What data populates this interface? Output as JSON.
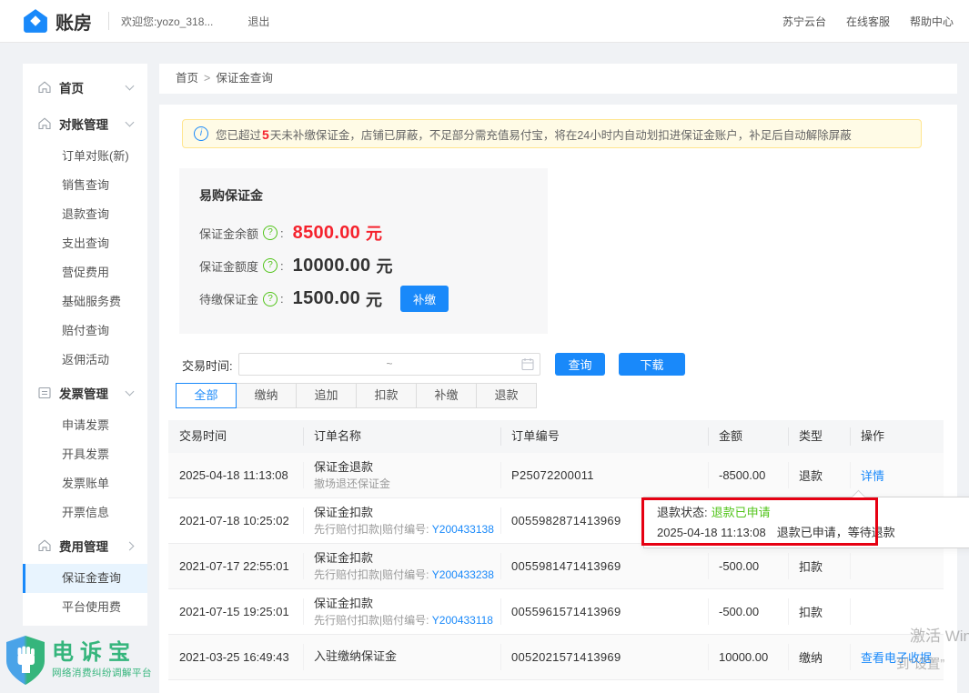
{
  "header": {
    "brand": "账房",
    "welcome": "欢迎您:yozo_318...",
    "logout": "退出",
    "nav": [
      "苏宁云台",
      "在线客服",
      "帮助中心"
    ]
  },
  "breadcrumb": {
    "home": "首页",
    "sep": ">",
    "current": "保证金查询"
  },
  "sidebar": {
    "items": [
      {
        "label": "首页"
      },
      {
        "label": "对账管理"
      },
      {
        "label": "订单对账(新)"
      },
      {
        "label": "销售查询"
      },
      {
        "label": "退款查询"
      },
      {
        "label": "支出查询"
      },
      {
        "label": "营促费用"
      },
      {
        "label": "基础服务费"
      },
      {
        "label": "赔付查询"
      },
      {
        "label": "返佣活动"
      },
      {
        "label": "发票管理"
      },
      {
        "label": "申请发票"
      },
      {
        "label": "开具发票"
      },
      {
        "label": "发票账单"
      },
      {
        "label": "开票信息"
      },
      {
        "label": "费用管理"
      },
      {
        "label": "保证金查询"
      },
      {
        "label": "平台使用费"
      }
    ],
    "selected": "保证金查询"
  },
  "banner": {
    "info_glyph": "i",
    "before": "您已超过",
    "highlight": "5",
    "after": "天未补缴保证金，店铺已屏蔽，不足部分需充值易付宝，将在24小时内自动划扣进保证金账户，补足后自动解除屏蔽"
  },
  "deposit_panel": {
    "title": "易购保证金",
    "help_glyph": "?",
    "rows": [
      {
        "label": "保证金余额",
        "value": "8500.00",
        "unit": "元"
      },
      {
        "label": "保证金额度",
        "value": "10000.00",
        "unit": "元"
      },
      {
        "label": "待缴保证金",
        "value": "1500.00",
        "unit": "元",
        "button": "补缴"
      }
    ]
  },
  "filter": {
    "label": "交易时间:",
    "range_placeholder": "~",
    "query_button": "查询",
    "download_button": "下载"
  },
  "tabs": {
    "items": [
      "全部",
      "缴纳",
      "追加",
      "扣款",
      "补缴",
      "退款"
    ],
    "active": "全部"
  },
  "table": {
    "columns": [
      "交易时间",
      "订单名称",
      "订单编号",
      "金额",
      "类型",
      "操作"
    ],
    "rows": [
      {
        "time": "2025-04-18 11:13:08",
        "name": "保证金退款",
        "sub": "撤场退还保证金",
        "sub_link": "",
        "order": "P25072200011",
        "amount": "-8500.00",
        "type": "退款",
        "action": "详情"
      },
      {
        "time": "2021-07-18 10:25:02",
        "name": "保证金扣款",
        "sub": "先行赔付扣款|赔付编号: ",
        "sub_link": "Y200433138",
        "order": "0055982871413969",
        "amount": "",
        "type": "",
        "action": ""
      },
      {
        "time": "2021-07-17 22:55:01",
        "name": "保证金扣款",
        "sub": "先行赔付扣款|赔付编号: ",
        "sub_link": "Y200433238",
        "order": "0055981471413969",
        "amount": "-500.00",
        "type": "扣款",
        "action": ""
      },
      {
        "time": "2021-07-15 19:25:01",
        "name": "保证金扣款",
        "sub": "先行赔付扣款|赔付编号: ",
        "sub_link": "Y200433118",
        "order": "0055961571413969",
        "amount": "-500.00",
        "type": "扣款",
        "action": ""
      },
      {
        "time": "2021-03-25 16:49:43",
        "name": "入驻缴纳保证金",
        "sub": "",
        "sub_link": "",
        "order": "0052021571413969",
        "amount": "10000.00",
        "type": "缴纳",
        "action": "查看电子收据"
      }
    ]
  },
  "tooltip": {
    "label": "退款状态:",
    "status": "退款已申请",
    "detail_time": "2025-04-18 11:13:08",
    "detail_text": "退款已申请，等待退款"
  },
  "watermark": {
    "line1": "激活 Windows",
    "line2": "到“设置”"
  },
  "footer_logo": {
    "name": "电诉宝",
    "subtitle": "网络消费纠纷调解平台"
  },
  "punct": {
    "colon": ":"
  },
  "colors": {
    "accent_blue": "#1989fa",
    "alert_red": "#f5222d",
    "status_green": "#52c41a",
    "annotation_red": "#e60012",
    "banner_bg": "#fffbe6",
    "banner_border": "#ffe58f"
  }
}
